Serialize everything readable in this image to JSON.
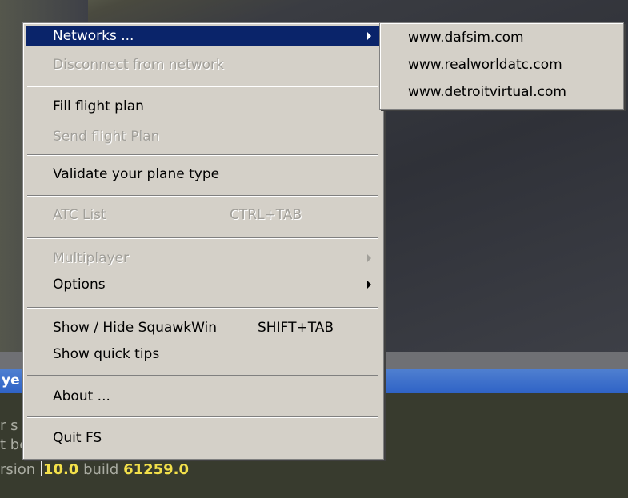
{
  "console": {
    "titlebar_fragment": "ye",
    "line1_fragment": "r s",
    "line2_fragment": "t be",
    "version_prefix": "rsion ",
    "version_value": "10.0",
    "build_label": " build ",
    "build_value": "61259.0"
  },
  "main_menu": {
    "networks": "Networks ...",
    "disconnect": "Disconnect from network",
    "fill_flight_plan": "Fill flight plan",
    "send_flight_plan": "Send flight Plan",
    "validate_plane": "Validate your plane type",
    "atc_list": "ATC List",
    "atc_list_shortcut": "CTRL+TAB",
    "multiplayer": "Multiplayer",
    "options": "Options",
    "squawkwin": "Show / Hide SquawkWin",
    "squawkwin_shortcut": "SHIFT+TAB",
    "quick_tips": "Show quick tips",
    "about": "About ...",
    "quit": "Quit FS"
  },
  "networks_submenu": [
    "www.dafsim.com",
    "www.realworldatc.com",
    "www.detroitvirtual.com"
  ],
  "colors": {
    "menu_bg": "#d4d0c8",
    "selection": "#0a246a",
    "disabled_text": "#a19f99",
    "titlebar": "#2f63c6",
    "console_highlight": "#f3e04a"
  }
}
